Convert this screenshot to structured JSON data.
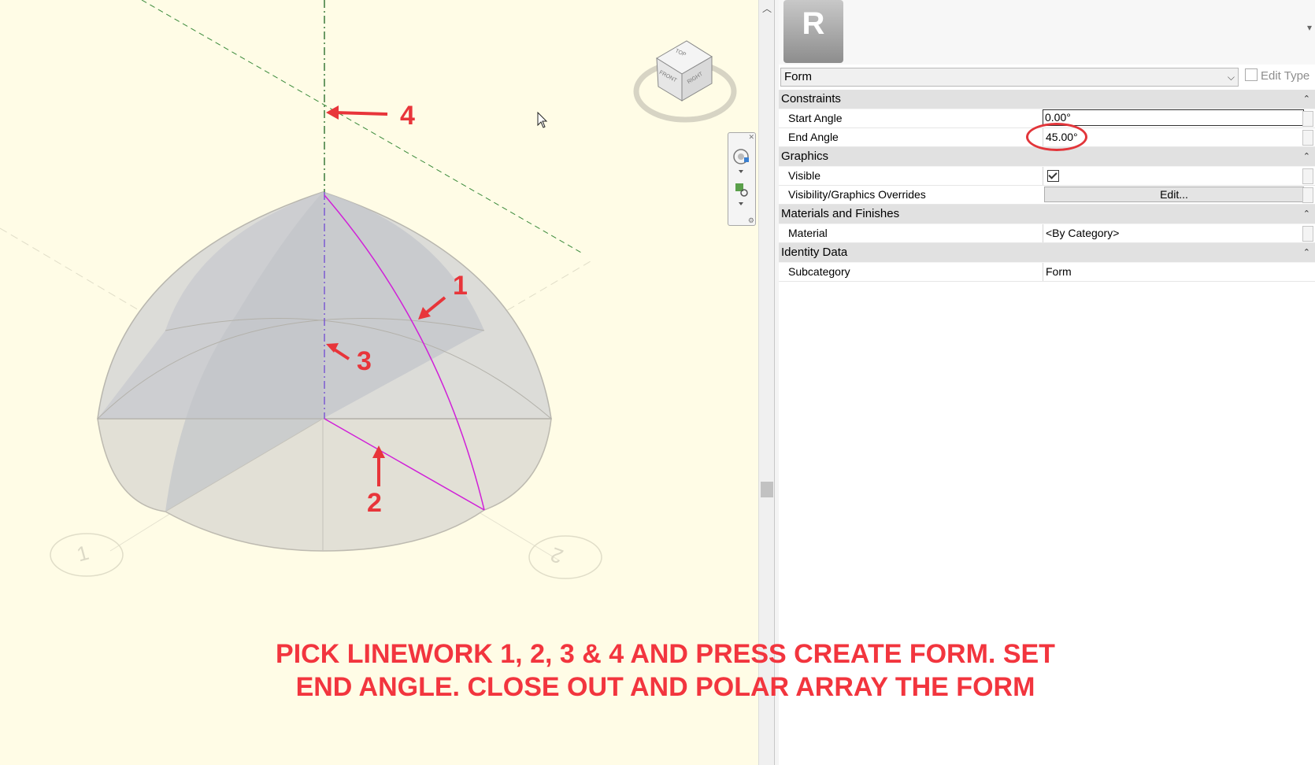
{
  "viewport": {
    "annotations": [
      {
        "id": "1",
        "label": "1"
      },
      {
        "id": "2",
        "label": "2"
      },
      {
        "id": "3",
        "label": "3"
      },
      {
        "id": "4",
        "label": "4"
      }
    ],
    "grid_bubbles": [
      "1",
      "2"
    ],
    "viewcube": {
      "top": "TOP",
      "front": "FRONT",
      "right": "RIGHT"
    },
    "caption_line1": "PICK LINEWORK 1, 2, 3 & 4 AND PRESS CREATE FORM.  SET",
    "caption_line2": "END ANGLE. CLOSE OUT AND POLAR ARRAY THE FORM",
    "highlight_color": "#e2353a",
    "selection_color": "#d020d8"
  },
  "properties": {
    "logo_letter": "R",
    "type_selector": "Form",
    "edit_type_label": "Edit Type",
    "categories": [
      {
        "name": "Constraints",
        "rows": [
          {
            "name": "Start Angle",
            "value": "0.00°"
          },
          {
            "name": "End Angle",
            "value": "45.00°"
          }
        ]
      },
      {
        "name": "Graphics",
        "rows": [
          {
            "name": "Visible",
            "value": "checked"
          },
          {
            "name": "Visibility/Graphics Overrides",
            "value": "Edit..."
          }
        ]
      },
      {
        "name": "Materials and Finishes",
        "rows": [
          {
            "name": "Material",
            "value": "<By Category>"
          }
        ]
      },
      {
        "name": "Identity Data",
        "rows": [
          {
            "name": "Subcategory",
            "value": "Form"
          }
        ]
      }
    ]
  }
}
